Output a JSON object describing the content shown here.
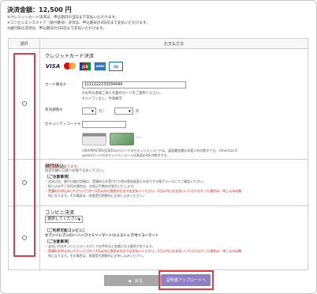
{
  "header": {
    "total": "決済金額：12,500 円",
    "notes": [
      "※クレジットカード決済は、申込期日の当日まで支払いただけます。",
      "※コンビニエンスストア（受付番号）決済は、申込期日の4日前まで支払いただけます。",
      "※銀行振込決済は、申込期日の5日前まで支払いただけます。"
    ]
  },
  "table": {
    "col_select": "選択",
    "col_method": "お支払方法"
  },
  "credit": {
    "title": "クレジットカード決済",
    "cards": [
      "VISA",
      "MasterCard",
      "JCB",
      "AMERICAN EXPRESS",
      "Diners Club"
    ],
    "card_number_label": "カード番号",
    "card_number_value": "1111222233334444",
    "card_number_help1": "※お申込者様ご本人名義のカードをご使用ください。",
    "card_number_help2": "※ハイフンなし、半角数字",
    "expiry_label": "有効期限",
    "month_value": "",
    "month_unit": "月 /",
    "year_value": "",
    "year_unit": "年",
    "security_label": "セキュリティコード",
    "security_value": "",
    "security_note1": "VISA/MASTER/JCB/Dinersカードのセキュリティコードは、裏面署名欄の末尾３桁の数字です。 American E",
    "security_note2": "xpressカードのセキュリティコードは表面の4桁の数字です。",
    "warning": "※1回払いになります。",
    "required_mark": "※"
  },
  "bank": {
    "title": "銀行振込",
    "desc": "指定の銀行口座へお振り込みください。",
    "notes_head": "［ご注意事項］",
    "note1": "・お振込先、銀行口座の詳細は、受講申込を受付けた時の登録画面とお送りする電子メールにてご確認ください。",
    "note2": "・振り込み手ご利用の場合は、お振込手数料が発生いたします。",
    "note3": "・受講をお申込みいただいた日から5日以内に指定の方法でお支払いください。5日以内にお支払いいただけなかった場合は、申し込みは無",
    "note4": "　効になります。その場合は、再度受付期間内にお申し込みください。"
  },
  "cvs": {
    "title": "コンビニ決済",
    "select_value": "選択してください",
    "stores_head": "［ご利用可能コンビニ］",
    "stores": "セブンイレブン/ローソン/ファミリーマート/ミニストップ/セイコーマート",
    "notes_head": "［ご注意事項］",
    "note1": "・支払い代金をコンビニエンスストアは予約など金額となる場合があります。",
    "note2": "・受講をお申込みいただいた日から3日以内に指定の方法でお支払いください。3日以内にお支払いいただけなかった場合は、申し込みは無",
    "note3": "　効になります。その場合は、再度受付期間内にお申し込みください。"
  },
  "buttons": {
    "back": "◀　戻る",
    "next": "証明書アップロードへ"
  },
  "colors": {
    "accent": "#8e7fc8",
    "highlight": "#e23b4b",
    "warning_text": "#d92020"
  }
}
